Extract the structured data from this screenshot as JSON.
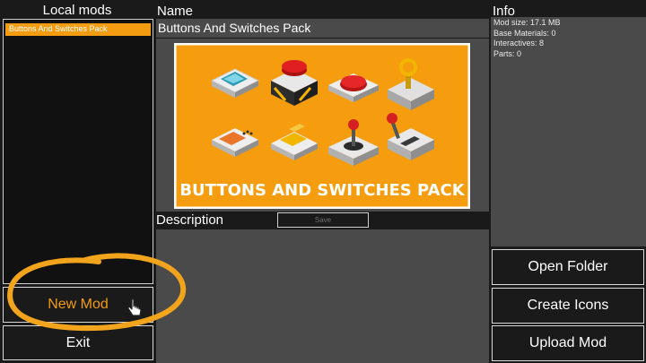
{
  "local_mods": {
    "title": "Local mods",
    "items": [
      {
        "label": "Buttons And Switches Pack",
        "selected": true
      }
    ]
  },
  "name_section": {
    "title": "Name",
    "mod_name": "Buttons And Switches Pack"
  },
  "preview": {
    "banner_text": "BUTTONS AND SWITCHES PACK",
    "background_color": "#f59d0f"
  },
  "description": {
    "title": "Description",
    "save_label": "Save"
  },
  "info": {
    "title": "Info",
    "lines": [
      "Mod size: 17.1 MB",
      "Base Materials: 0",
      "Interactives: 8",
      "Parts: 0"
    ]
  },
  "buttons": {
    "new_mod": "New Mod",
    "exit": "Exit",
    "open_folder": "Open Folder",
    "create_icons": "Create Icons",
    "upload_mod": "Upload Mod"
  },
  "colors": {
    "accent": "#f39c12",
    "annotation": "#f2a51c",
    "panel": "#4a4a4a",
    "background": "#1a1a1a"
  },
  "icons": [
    "pointer-cursor-icon"
  ]
}
